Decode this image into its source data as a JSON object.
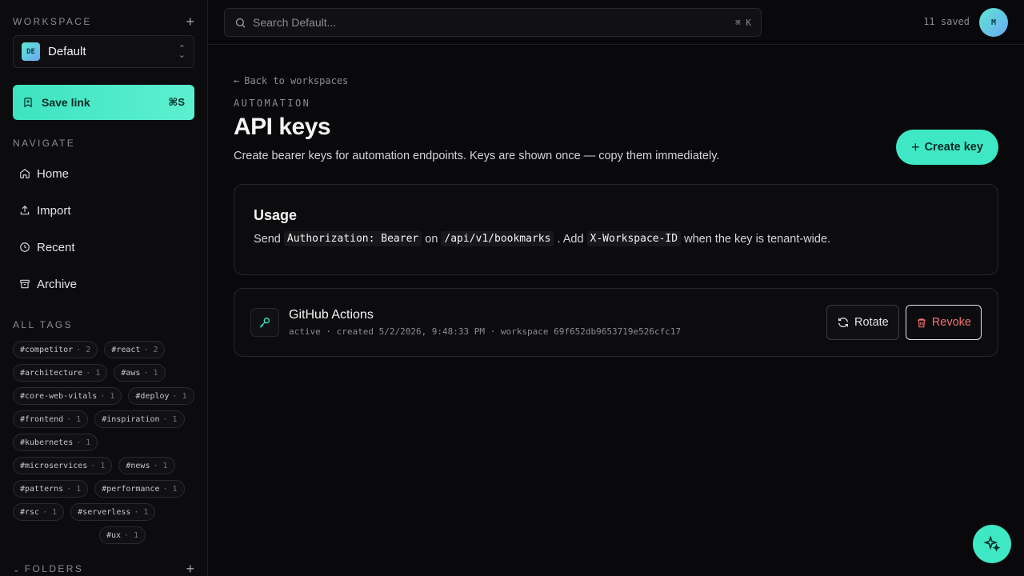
{
  "sidebar": {
    "workspace_heading": "WORKSPACE",
    "workspace": {
      "badge": "DE",
      "name": "Default"
    },
    "save_link": {
      "label": "Save link",
      "shortcut": "⌘S"
    },
    "navigate_heading": "NAVIGATE",
    "nav": [
      {
        "label": "Home",
        "icon": "home-icon"
      },
      {
        "label": "Import",
        "icon": "upload-icon"
      },
      {
        "label": "Recent",
        "icon": "clock-icon"
      },
      {
        "label": "Archive",
        "icon": "archive-icon"
      }
    ],
    "tags_heading": "ALL TAGS",
    "tags": [
      {
        "name": "#competitor",
        "count": "· 2"
      },
      {
        "name": "#react",
        "count": "· 2"
      },
      {
        "name": "#architecture",
        "count": "· 1"
      },
      {
        "name": "#aws",
        "count": "· 1"
      },
      {
        "name": "#core-web-vitals",
        "count": "· 1"
      },
      {
        "name": "#deploy",
        "count": "· 1"
      },
      {
        "name": "#frontend",
        "count": "· 1"
      },
      {
        "name": "#inspiration",
        "count": "· 1"
      },
      {
        "name": "#kubernetes",
        "count": "· 1"
      },
      {
        "name": "#microservices",
        "count": "· 1"
      },
      {
        "name": "#news",
        "count": "· 1"
      },
      {
        "name": "#patterns",
        "count": "· 1"
      },
      {
        "name": "#performance",
        "count": "· 1"
      },
      {
        "name": "#rsc",
        "count": "· 1"
      },
      {
        "name": "#serverless",
        "count": "· 1"
      },
      {
        "name": "#ux",
        "count": "· 1"
      }
    ],
    "folders_heading": "Folders"
  },
  "topbar": {
    "search_placeholder": "Search Default...",
    "search_shortcut": "⌘ K",
    "saved_count": "11 saved",
    "avatar_initial": "M"
  },
  "main": {
    "back_link": "Back to workspaces",
    "eyebrow": "AUTOMATION",
    "title": "API keys",
    "subtitle": "Create bearer keys for automation endpoints. Keys are shown once — copy them immediately.",
    "create_button": "Create key",
    "usage": {
      "title": "Usage",
      "t1": "Send",
      "c1": "Authorization: Bearer",
      "t2": "on",
      "c2": "/api/v1/bookmarks",
      "t3": ". Add",
      "c3": "X-Workspace-ID",
      "t4": "when the key is tenant-wide."
    },
    "keys": [
      {
        "name": "GitHub Actions",
        "meta": "active · created 5/2/2026, 9:48:33 PM · workspace 69f652db9653719e526cfc17",
        "rotate_label": "Rotate",
        "revoke_label": "Revoke"
      }
    ]
  },
  "colors": {
    "accent": "#3ee8c4",
    "danger": "#f87171",
    "background": "#09090b"
  }
}
